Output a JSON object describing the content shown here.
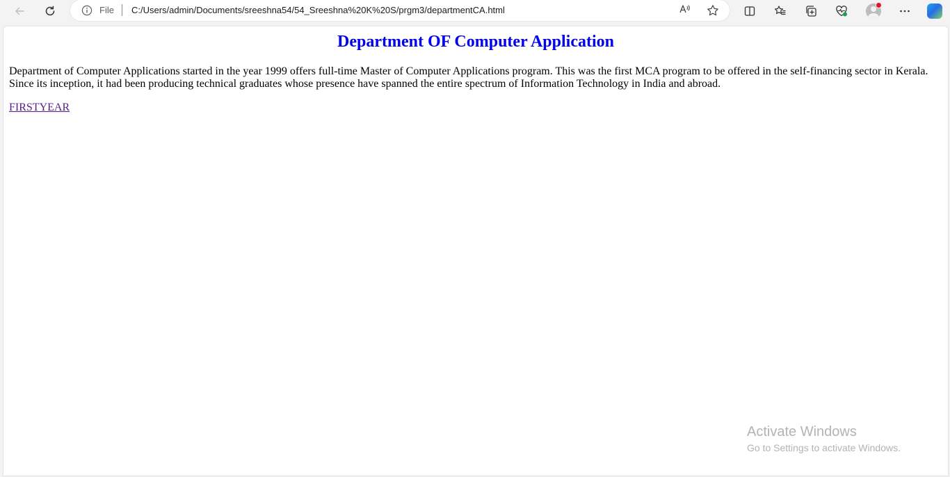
{
  "browser": {
    "address_bar": {
      "scheme_label": "File",
      "url": "C:/Users/admin/Documents/sreeshna54/54_Sreeshna%20K%20S/prgm3/departmentCA.html"
    },
    "icons": {
      "back": "back-arrow-icon",
      "refresh": "refresh-icon",
      "info": "info-icon",
      "read_aloud": "read-aloud-icon",
      "favorite": "star-icon",
      "split_screen": "split-screen-icon",
      "favorites": "favorites-icon",
      "collections": "collections-icon",
      "browser_essentials": "heart-pulse-icon",
      "profile": "profile-avatar-icon",
      "more": "more-icon",
      "copilot": "copilot-icon"
    },
    "read_aloud_glyph": "A⁾"
  },
  "page": {
    "title": "Department OF Computer Application",
    "paragraph": "Department of Computer Applications started in the year 1999 offers full-time Master of Computer Applications program. This was the first MCA program to be offered in the self-financing sector in Kerala. Since its inception, it had been producing technical graduates whose presence have spanned the entire spectrum of Information Technology in India and abroad.",
    "link_label": "FIRSTYEAR",
    "title_color": "#0000ee",
    "visited_link_color": "#551a8b"
  },
  "watermark": {
    "title": "Activate Windows",
    "subtitle": "Go to Settings to activate Windows."
  }
}
